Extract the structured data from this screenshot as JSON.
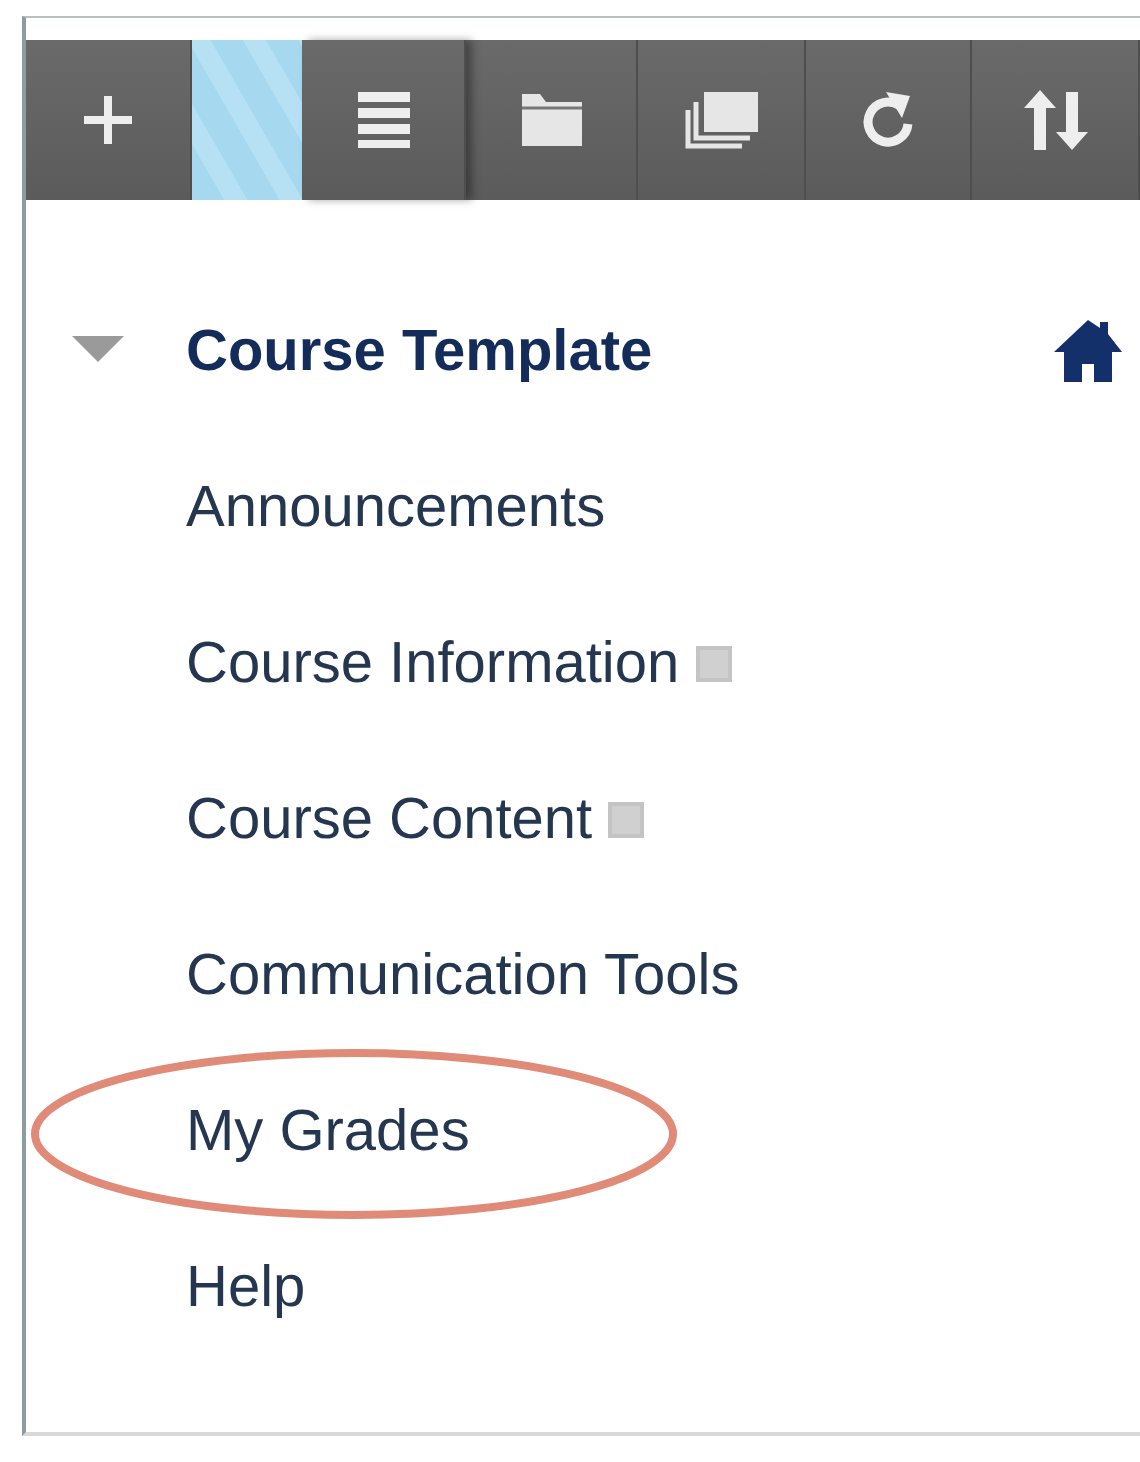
{
  "toolbar": {
    "buttons": [
      {
        "kind": "add"
      },
      {
        "kind": "handle"
      },
      {
        "kind": "list"
      },
      {
        "kind": "folder"
      },
      {
        "kind": "windows"
      },
      {
        "kind": "refresh"
      },
      {
        "kind": "sort"
      }
    ]
  },
  "course_menu": {
    "title": "Course Template",
    "expanded": true,
    "items": [
      {
        "label": "Announcements",
        "kind": "link",
        "circled": false
      },
      {
        "label": "Course Information",
        "kind": "hidden-link",
        "circled": false
      },
      {
        "label": "Course Content",
        "kind": "hidden-link",
        "circled": false
      },
      {
        "label": "Communication Tools",
        "kind": "link",
        "circled": false
      },
      {
        "label": "My Grades",
        "kind": "link",
        "circled": true
      },
      {
        "label": "Help",
        "kind": "link",
        "circled": false
      }
    ]
  }
}
